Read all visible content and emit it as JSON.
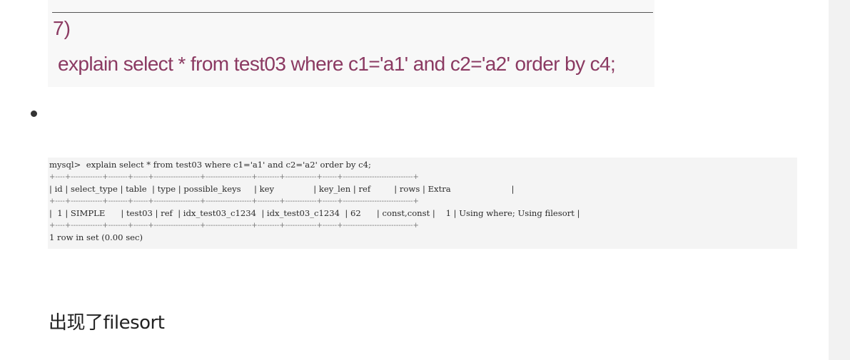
{
  "top_image": {
    "step_label": "7)",
    "sql": "explain select * from test03 where c1='a1' and c2='a2' order by c4;"
  },
  "terminal": {
    "command": "mysql>  explain select * from test03 where c1='a1' and c2='a2' order by c4;",
    "border_line": "+----+-------------+--------+------+-------------------+-------------------+---------+-------------+------+-----------------------------+",
    "header_row": "| id | select_type | table  | type | possible_keys     | key               | key_len | ref         | rows | Extra                       |",
    "data_row": "|  1 | SIMPLE      | test03 | ref  | idx_test03_c1234  | idx_test03_c1234  | 62      | const,const |    1 | Using where; Using filesort |",
    "footer": "1 row in set (0.00 sec)",
    "columns": [
      "id",
      "select_type",
      "table",
      "type",
      "possible_keys",
      "key",
      "key_len",
      "ref",
      "rows",
      "Extra"
    ],
    "rows": [
      [
        "1",
        "SIMPLE",
        "test03",
        "ref",
        "idx_test03_c1234",
        "idx_test03_c1234",
        "62",
        "const,const",
        "1",
        "Using where; Using filesort"
      ]
    ]
  },
  "caption": "出现了filesort"
}
